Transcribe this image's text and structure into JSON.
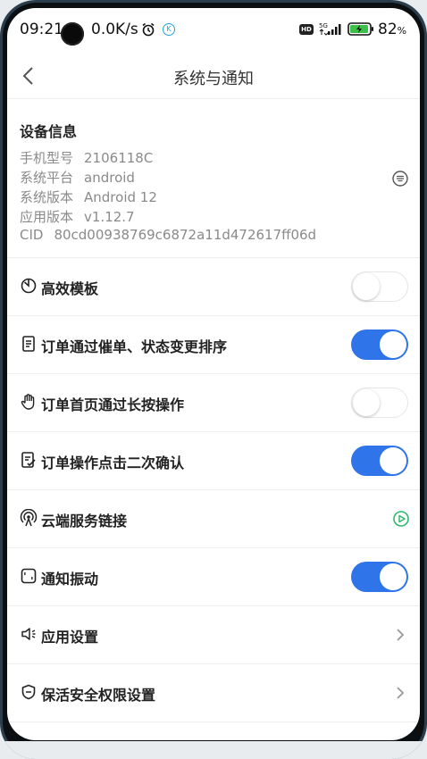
{
  "status_bar": {
    "time": "09:21",
    "net_speed": "0.0K/s",
    "battery": "82",
    "battery_unit": "%",
    "icons": [
      "alarm-icon",
      "k-icon",
      "hd-icon",
      "signal-5g-icon",
      "battery-charging-icon"
    ],
    "network_label": "5G",
    "hd_label": "HD"
  },
  "header": {
    "title": "系统与通知",
    "back_icon": "chevron-left-icon"
  },
  "device_info": {
    "title": "设备信息",
    "rows": [
      {
        "label": "手机型号",
        "value": "2106118C"
      },
      {
        "label": "系统平台",
        "value": "android"
      },
      {
        "label": "系统版本",
        "value": "Android 12"
      },
      {
        "label": "应用版本",
        "value": "v1.12.7"
      },
      {
        "label": "CID",
        "value": "80cd00938769c6872a11d472617ff06d"
      }
    ],
    "action_icon": "list-circle-icon"
  },
  "settings": [
    {
      "label": "高效模板",
      "icon": "timer-icon",
      "control": "toggle",
      "on": false
    },
    {
      "label": "订单通过催单、状态变更排序",
      "icon": "document-icon",
      "control": "toggle",
      "on": true
    },
    {
      "label": "订单首页通过长按操作",
      "icon": "hand-icon",
      "control": "toggle",
      "on": false
    },
    {
      "label": "订单操作点击二次确认",
      "icon": "checklist-icon",
      "control": "toggle",
      "on": true
    },
    {
      "label": "云端服务链接",
      "icon": "signal-tower-icon",
      "control": "play",
      "on": null
    },
    {
      "label": "通知振动",
      "icon": "vibrate-icon",
      "control": "toggle",
      "on": true
    },
    {
      "label": "应用设置",
      "icon": "speaker-icon",
      "control": "chevron",
      "on": null
    },
    {
      "label": "保活安全权限设置",
      "icon": "shield-icon",
      "control": "chevron",
      "on": null
    }
  ],
  "colors": {
    "accent": "#2f74e9",
    "play_green": "#2fb86b",
    "text_primary": "#222222",
    "text_secondary": "#8a8a8a"
  }
}
